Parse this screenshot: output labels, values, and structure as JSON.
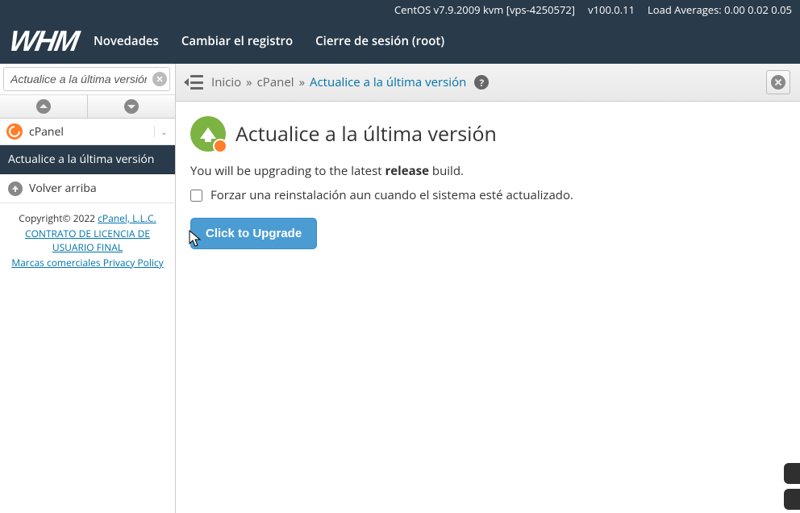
{
  "status": {
    "os": "CentOS v7.9.2009 kvm [vps-4250572]",
    "version": "v100.0.11",
    "load_label": "Load Averages:",
    "load_values": "0.00 0.02 0.05"
  },
  "header": {
    "logo": "WHM",
    "nav": {
      "news": "Novedades",
      "changelog": "Cambiar el registro",
      "logout": "Cierre de sesión (root)"
    }
  },
  "sidebar": {
    "search_value": "Actualice a la última versión",
    "category": {
      "label": "cPanel"
    },
    "item_selected": "Actualice a la última versión",
    "back_top": "Volver arriba",
    "footer": {
      "copyright": "Copyright© 2022 ",
      "company": "cPanel, L.L.C.",
      "eula": "CONTRATO DE LICENCIA DE USUARIO FINAL",
      "trademarks": "Marcas comerciales ",
      "privacy": "Privacy Policy"
    }
  },
  "breadcrumb": {
    "home": "Inicio",
    "sep": "»",
    "section": "cPanel",
    "page": "Actualice a la última versión",
    "help": "?"
  },
  "main": {
    "title": "Actualice a la última versión",
    "notice_pre": "You will be upgrading to the latest ",
    "notice_bold": "release",
    "notice_post": " build.",
    "checkbox_label": "Forzar una reinstalación aun cuando el sistema esté actualizado.",
    "button": "Click to Upgrade"
  }
}
